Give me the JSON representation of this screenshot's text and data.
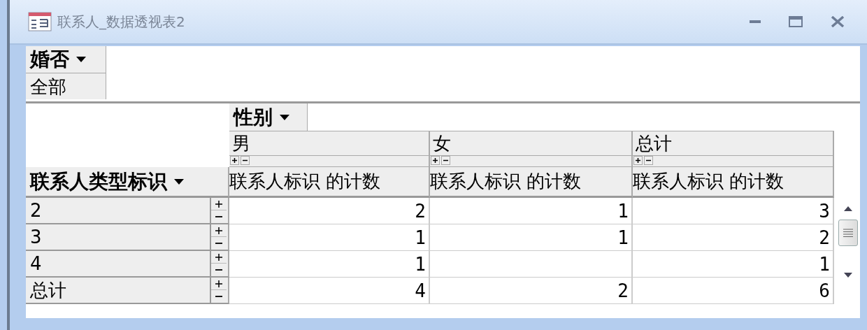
{
  "window": {
    "title": "联系人_数据透视表2"
  },
  "filter_field": {
    "name": "婚否",
    "value": "全部"
  },
  "column_field": {
    "name": "性别"
  },
  "row_field": {
    "name": "联系人类型标识"
  },
  "columns": [
    {
      "label": "男",
      "measure": "联系人标识 的计数"
    },
    {
      "label": "女",
      "measure": "联系人标识 的计数"
    },
    {
      "label": "总计",
      "measure": "联系人标识 的计数"
    }
  ],
  "rows": [
    {
      "label": "2",
      "cells": [
        {
          "kind": "value",
          "value": "2"
        },
        {
          "kind": "value",
          "value": "1"
        },
        {
          "kind": "value",
          "value": "3"
        }
      ]
    },
    {
      "label": "3",
      "cells": [
        {
          "kind": "value",
          "value": "1"
        },
        {
          "kind": "value",
          "value": "1"
        },
        {
          "kind": "value",
          "value": "2"
        }
      ]
    },
    {
      "label": "4",
      "cells": [
        {
          "kind": "value",
          "value": "1"
        },
        {
          "kind": "blank"
        },
        {
          "kind": "value",
          "value": "1"
        }
      ]
    },
    {
      "label": "总计",
      "cells": [
        {
          "kind": "value",
          "value": "4"
        },
        {
          "kind": "value",
          "value": "2"
        },
        {
          "kind": "value",
          "value": "6"
        }
      ]
    }
  ]
}
